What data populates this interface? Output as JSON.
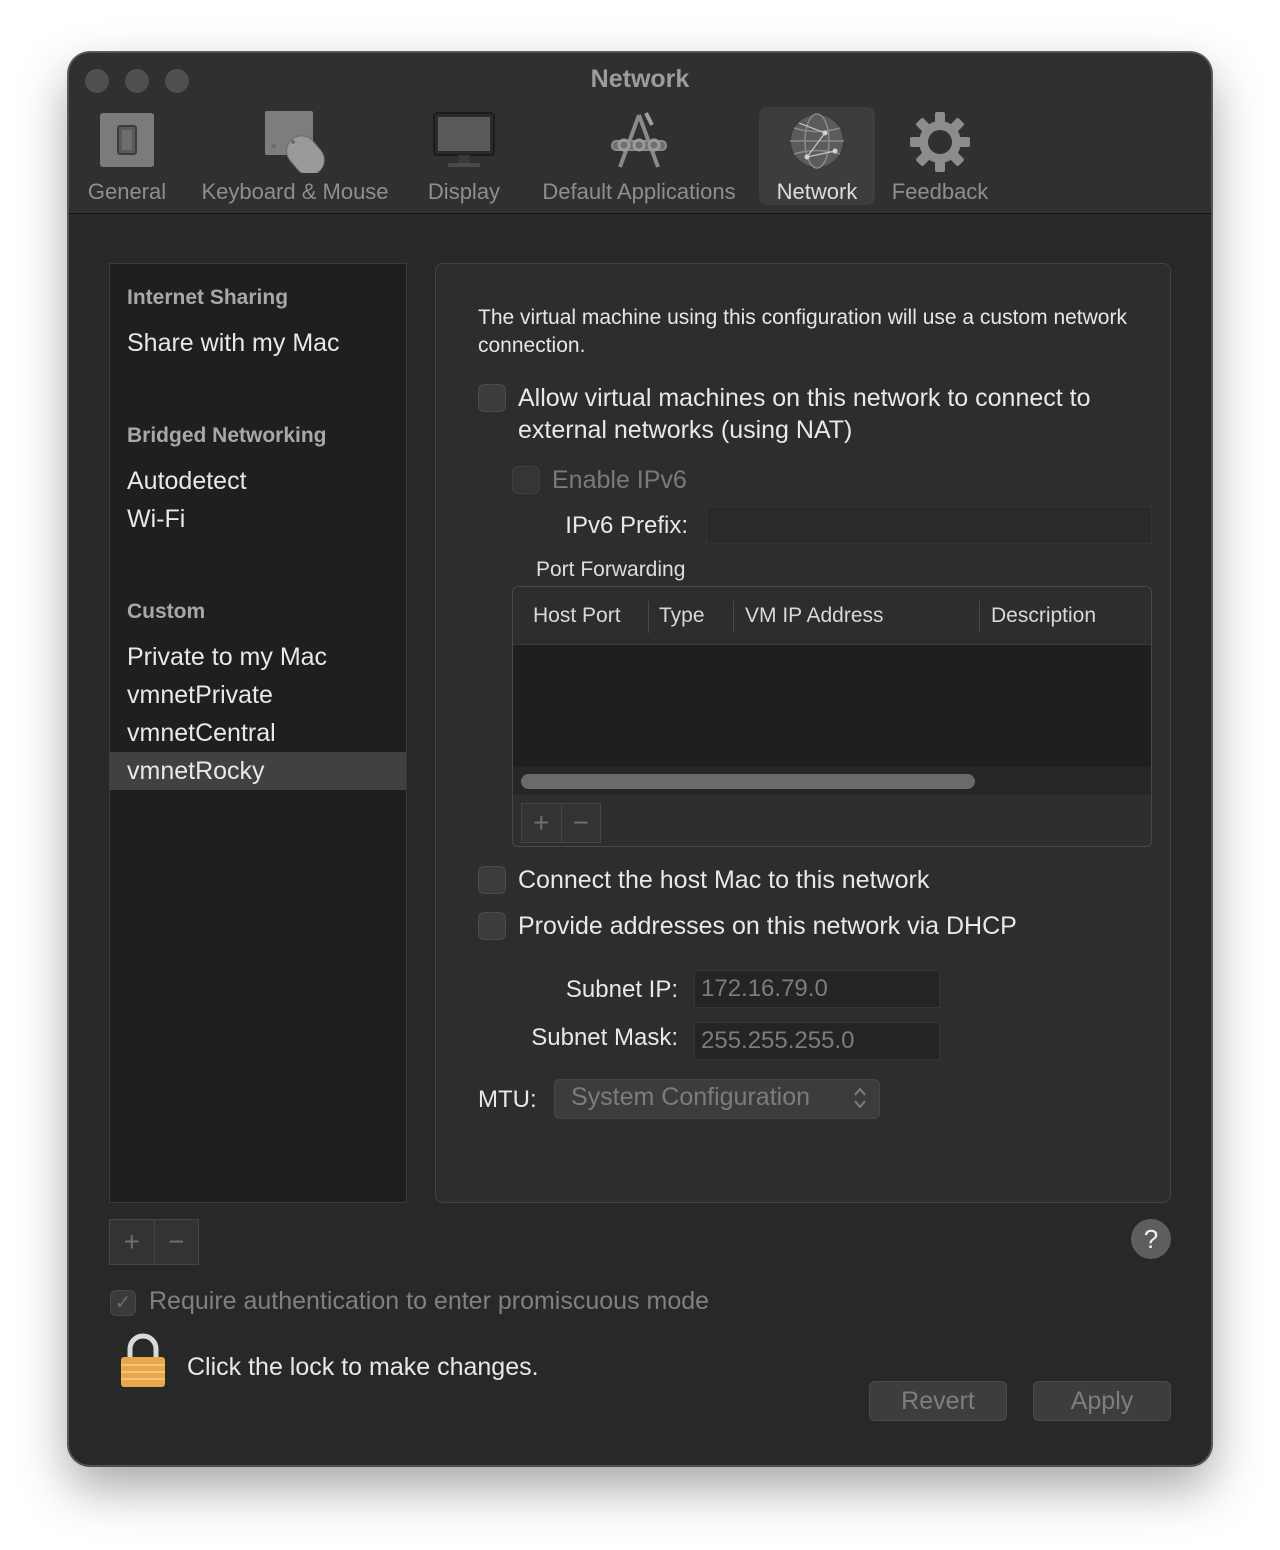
{
  "window": {
    "title": "Network"
  },
  "toolbar": {
    "items": [
      {
        "label": "General",
        "icon": "general-icon"
      },
      {
        "label": "Keyboard & Mouse",
        "icon": "keyboard-mouse-icon"
      },
      {
        "label": "Display",
        "icon": "display-icon"
      },
      {
        "label": "Default Applications",
        "icon": "default-applications-icon"
      },
      {
        "label": "Network",
        "icon": "network-globe-icon",
        "active": true
      },
      {
        "label": "Feedback",
        "icon": "gear-icon"
      }
    ]
  },
  "sidebar": {
    "sections": [
      {
        "header": "Internet Sharing",
        "items": [
          "Share with my Mac"
        ]
      },
      {
        "header": "Bridged Networking",
        "items": [
          "Autodetect",
          "Wi-Fi"
        ]
      },
      {
        "header": "Custom",
        "items": [
          "Private to my Mac",
          "vmnetPrivate",
          "vmnetCentral",
          "vmnetRocky"
        ]
      }
    ],
    "selected": "vmnetRocky",
    "add_label": "+",
    "remove_label": "−"
  },
  "panel": {
    "description": "The virtual machine using this configuration will use a custom network connection.",
    "nat_label": "Allow virtual machines on this network to connect to external networks (using NAT)",
    "ipv6_label": "Enable IPv6",
    "ipv6_prefix_label": "IPv6 Prefix:",
    "ipv6_prefix_value": "",
    "port_forwarding": {
      "title": "Port Forwarding",
      "columns": [
        "Host Port",
        "Type",
        "VM IP Address",
        "Description"
      ],
      "rows": [],
      "add_label": "+",
      "remove_label": "−"
    },
    "connect_host_label": "Connect the host Mac to this network",
    "dhcp_label": "Provide addresses on this network via DHCP",
    "subnet_ip_label": "Subnet IP:",
    "subnet_ip_value": "172.16.79.0",
    "subnet_mask_label": "Subnet Mask:",
    "subnet_mask_value": "255.255.255.0",
    "mtu_label": "MTU:",
    "mtu_value": "System Configuration"
  },
  "footer": {
    "help_label": "?",
    "auth_label": "Require authentication to enter promiscuous mode",
    "auth_checked": true,
    "lock_label": "Click the lock to make changes.",
    "revert_label": "Revert",
    "apply_label": "Apply"
  }
}
